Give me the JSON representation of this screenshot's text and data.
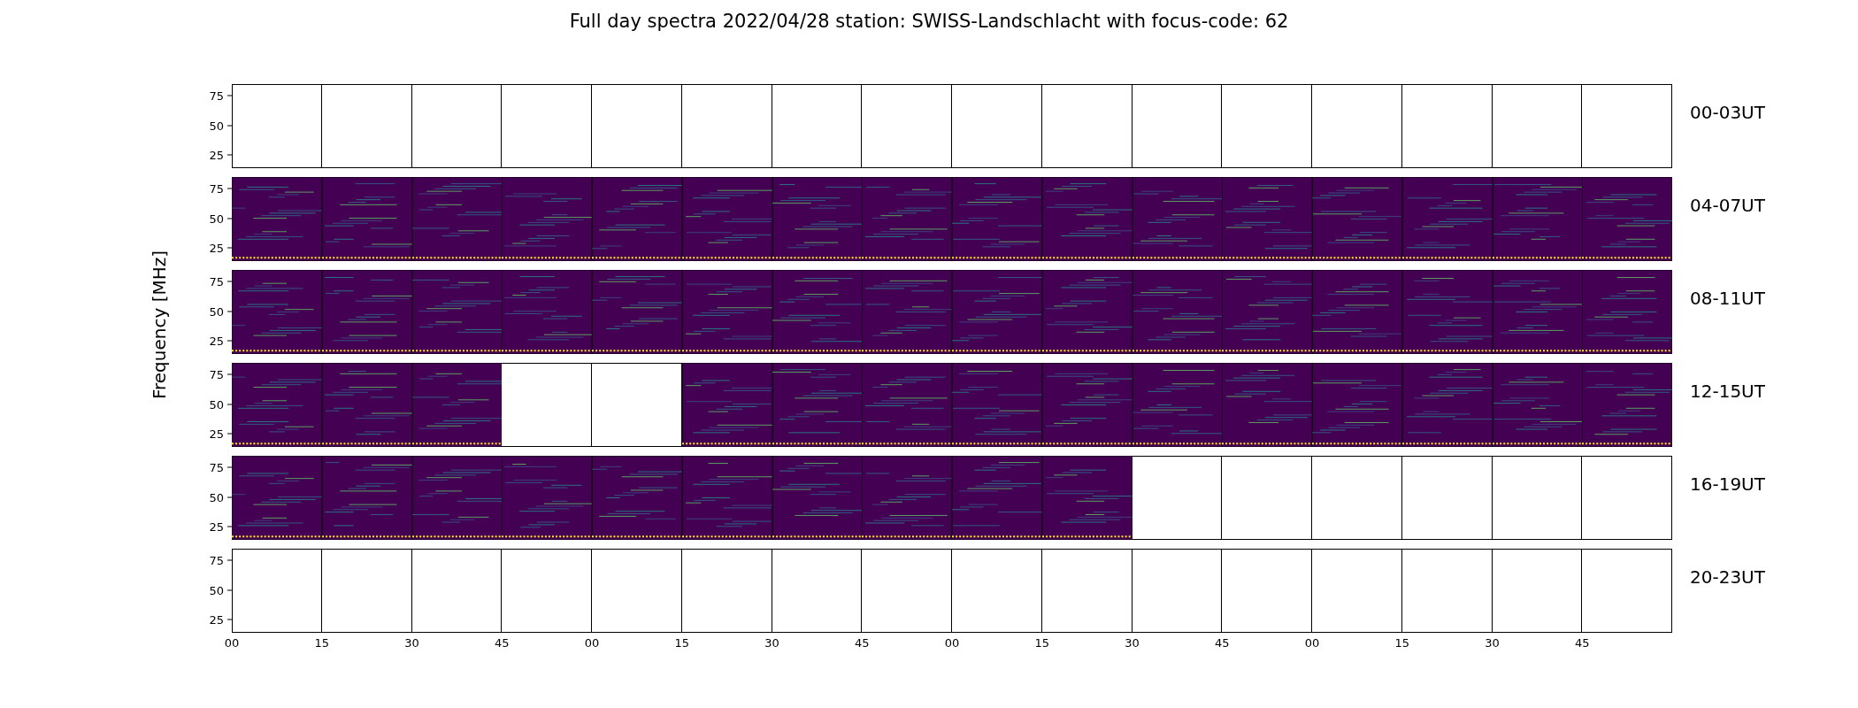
{
  "title": "Full day spectra 2022/04/28 station: SWISS-Landschlacht with focus-code: 62",
  "ylabel": "Frequency [MHz]",
  "rows": [
    {
      "label": "00-03UT",
      "yticks": [
        "75",
        "50",
        "25"
      ],
      "panels": [
        false,
        false,
        false,
        false,
        false,
        false,
        false,
        false,
        false,
        false,
        false,
        false,
        false,
        false,
        false,
        false
      ]
    },
    {
      "label": "04-07UT",
      "yticks": [
        "75",
        "50",
        "25"
      ],
      "panels": [
        true,
        true,
        true,
        true,
        true,
        true,
        true,
        true,
        true,
        true,
        true,
        true,
        true,
        true,
        true,
        true
      ]
    },
    {
      "label": "08-11UT",
      "yticks": [
        "75",
        "50",
        "25"
      ],
      "panels": [
        true,
        true,
        true,
        true,
        true,
        true,
        true,
        true,
        true,
        true,
        true,
        true,
        true,
        true,
        true,
        true
      ]
    },
    {
      "label": "12-15UT",
      "yticks": [
        "75",
        "50",
        "25"
      ],
      "panels": [
        true,
        true,
        true,
        false,
        false,
        true,
        true,
        true,
        true,
        true,
        true,
        true,
        true,
        true,
        true,
        true
      ]
    },
    {
      "label": "16-19UT",
      "yticks": [
        "75",
        "50",
        "25"
      ],
      "panels": [
        true,
        true,
        true,
        true,
        true,
        true,
        true,
        true,
        true,
        true,
        false,
        false,
        false,
        false,
        false,
        false
      ]
    },
    {
      "label": "20-23UT",
      "yticks": [
        "75",
        "50",
        "25"
      ],
      "panels": [
        false,
        false,
        false,
        false,
        false,
        false,
        false,
        false,
        false,
        false,
        false,
        false,
        false,
        false,
        false,
        false
      ]
    }
  ],
  "xticks": [
    "00",
    "15",
    "30",
    "45",
    "00",
    "15",
    "30",
    "45",
    "00",
    "15",
    "30",
    "45",
    "00",
    "15",
    "30",
    "45"
  ]
}
